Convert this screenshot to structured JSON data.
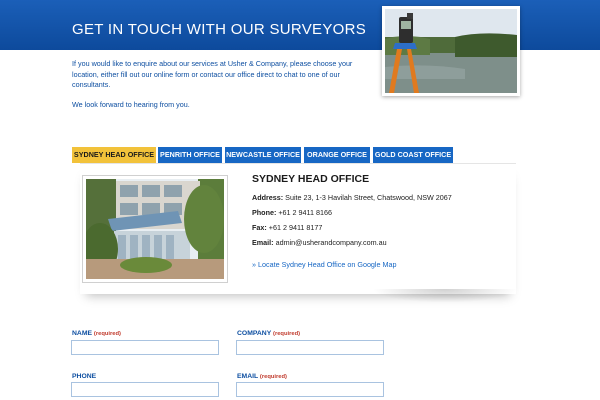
{
  "header": {
    "title": "GET IN TOUCH WITH OUR SURVEYORS",
    "intro_paragraph": "If you would like to enquire about our services at Usher & Company, please choose your location, either fill out our online form or contact our office direct to chat to one of our consultants.",
    "closing_paragraph": "We look forward to hearing from you."
  },
  "tabs": [
    {
      "label": "SYDNEY HEAD OFFICE",
      "active": true
    },
    {
      "label": "PENRITH OFFICE",
      "active": false
    },
    {
      "label": "NEWCASTLE OFFICE",
      "active": false
    },
    {
      "label": "ORANGE OFFICE",
      "active": false
    },
    {
      "label": "GOLD COAST OFFICE",
      "active": false
    }
  ],
  "office": {
    "name": "SYDNEY HEAD OFFICE",
    "address_label": "Address:",
    "address": "Suite 23, 1-3 Havilah Street, Chatswood, NSW 2067",
    "phone_label": "Phone:",
    "phone": "+61 2 9411 8166",
    "fax_label": "Fax:",
    "fax": "+61 2 9411 8177",
    "email_label": "Email:",
    "email": "admin@usherandcompany.com.au",
    "map_link": "» Locate Sydney Head Office on Google Map"
  },
  "form": {
    "required_marker": "(required)",
    "name_label": "NAME",
    "company_label": "COMPANY",
    "phone_label": "PHONE",
    "email_label": "EMAIL",
    "name_value": "",
    "company_value": "",
    "phone_value": "",
    "email_value": ""
  },
  "colors": {
    "brand_blue": "#0e4fa1",
    "tab_blue": "#1767c4",
    "active_tab": "#f2c23a",
    "required_red": "#c0392b"
  },
  "icons": {
    "hero_photo": "surveyor-total-station-photo",
    "office_photo": "office-building-photo"
  }
}
